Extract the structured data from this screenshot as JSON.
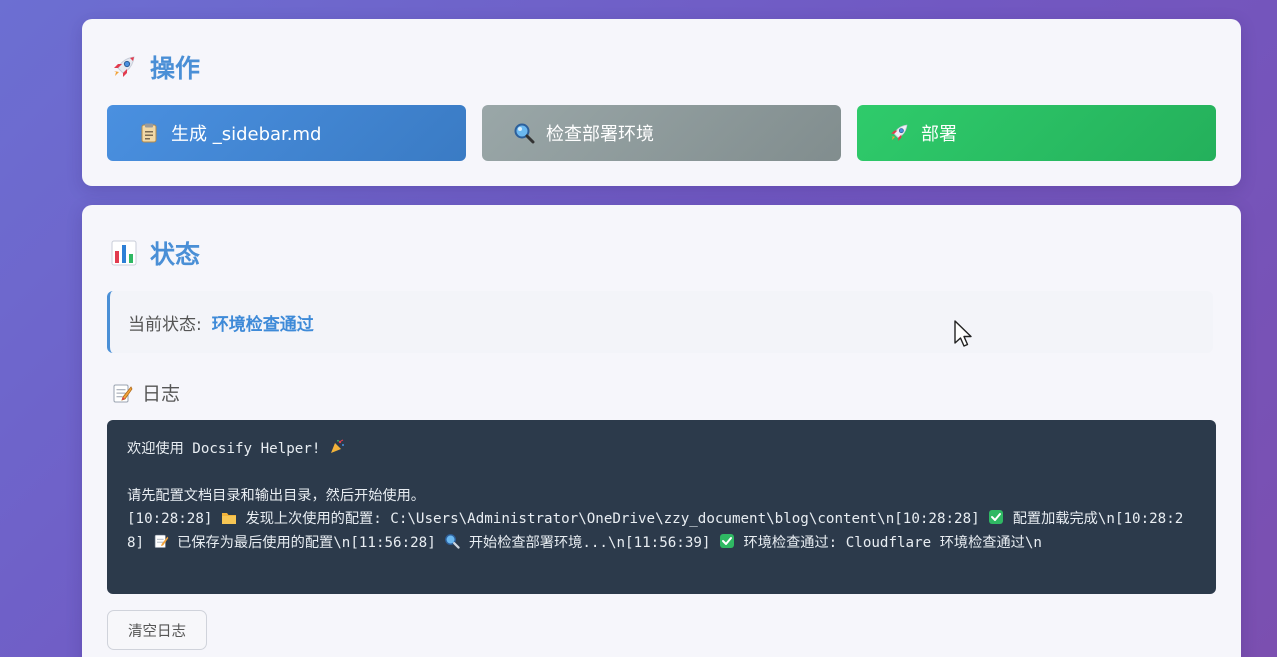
{
  "actions": {
    "title": "操作",
    "generate_label": "生成 _sidebar.md",
    "check_label": "检查部署环境",
    "deploy_label": "部署"
  },
  "status": {
    "title": "状态",
    "current_label": "当前状态:",
    "current_value": "环境检查通过"
  },
  "log": {
    "title": "日志",
    "welcome": "欢迎使用 Docsify Helper! ",
    "hint": "请先配置文档目录和输出目录，然后开始使用。",
    "seg1": "[10:28:28] ",
    "seg2": " 发现上次使用的配置: C:\\Users\\Administrator\\OneDrive\\zzy_document\\blog\\content\\n[10:28:28] ",
    "seg3": " 配置加载完成\\n[10:28:28] ",
    "seg4": " 已保存为最后使用的配置\\n[11:56:28] ",
    "seg5": " 开始检查部署环境...\\n[11:56:39] ",
    "seg6": " 环境检查通过: Cloudflare 环境检查通过\\n",
    "clear_label": "清空日志"
  },
  "colors": {
    "accent": "#4a8fd6",
    "generate": "#3f84d0",
    "check": "#8e9a9b",
    "deploy": "#2abd63",
    "log_bg": "#2c3a4b"
  },
  "icons": {
    "actions_title": "rocket-icon",
    "generate": "clipboard-icon",
    "check": "magnifier-icon",
    "deploy": "rocket-icon",
    "status_title": "bar-chart-icon",
    "log_title": "memo-icon"
  }
}
